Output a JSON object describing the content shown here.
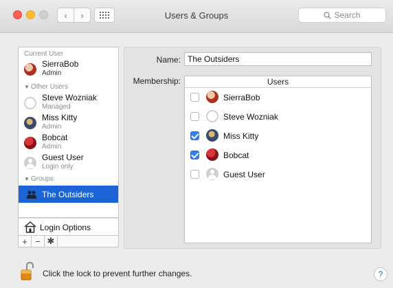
{
  "window": {
    "title": "Users & Groups"
  },
  "toolbar": {
    "search_placeholder": "Search"
  },
  "sidebar": {
    "current_user_header": "Current User",
    "current_user": {
      "name": "SierraBob",
      "role": "Admin"
    },
    "other_users_header": "Other Users",
    "other_users": [
      {
        "name": "Steve Wozniak",
        "role": "Managed"
      },
      {
        "name": "Miss Kitty",
        "role": "Admin"
      },
      {
        "name": "Bobcat",
        "role": "Admin"
      },
      {
        "name": "Guest User",
        "role": "Login only"
      }
    ],
    "groups_header": "Groups",
    "groups": [
      {
        "name": "The Outsiders",
        "selected": true
      }
    ],
    "login_options": "Login Options",
    "buttons": {
      "add": "+",
      "remove": "−",
      "action": "✱"
    }
  },
  "detail": {
    "name_label": "Name:",
    "name_value": "The Outsiders",
    "membership_label": "Membership:",
    "table_header": "Users",
    "members": [
      {
        "name": "SierraBob",
        "checked": false
      },
      {
        "name": "Steve Wozniak",
        "checked": false
      },
      {
        "name": "Miss Kitty",
        "checked": true
      },
      {
        "name": "Bobcat",
        "checked": true
      },
      {
        "name": "Guest User",
        "checked": false
      }
    ]
  },
  "footer": {
    "lock_text": "Click the lock to prevent further changes.",
    "help": "?"
  },
  "colors": {
    "selection": "#1a64d6",
    "checkbox_on": "#2f7ff6"
  }
}
